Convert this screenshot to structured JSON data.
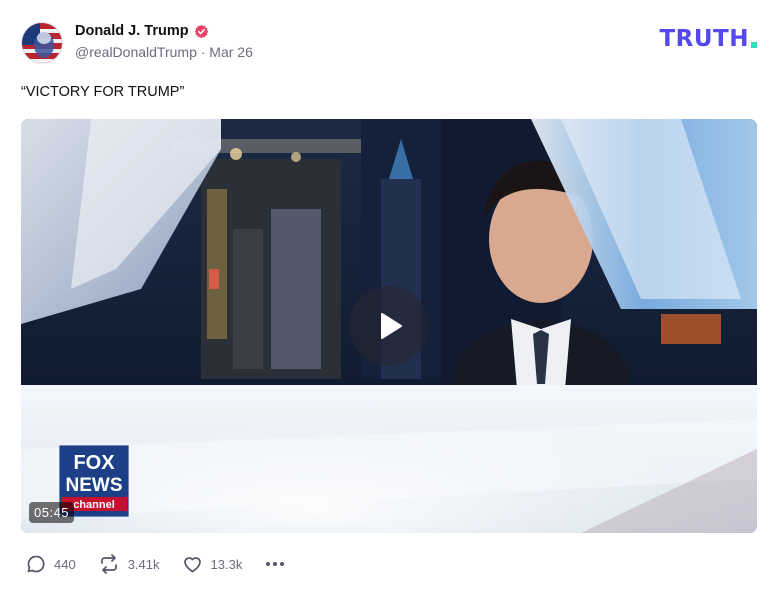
{
  "post": {
    "author_name": "Donald J. Trump",
    "handle_date": "@realDonaldTrump · Mar 26",
    "text": "“VICTORY FOR TRUMP”"
  },
  "brand": {
    "logo_text": "TRUTH",
    "accent": "#5448ee",
    "dot_color": "#2ee0b8"
  },
  "media": {
    "duration": "05:45",
    "network_logo_text": [
      "FOX",
      "NEWS",
      "channel"
    ]
  },
  "actions": {
    "replies": "440",
    "retruths": "3.41k",
    "likes": "13.3k"
  },
  "icons": [
    "verified-badge-icon",
    "play-icon",
    "reply-icon",
    "retruth-icon",
    "like-icon",
    "more-icon"
  ]
}
